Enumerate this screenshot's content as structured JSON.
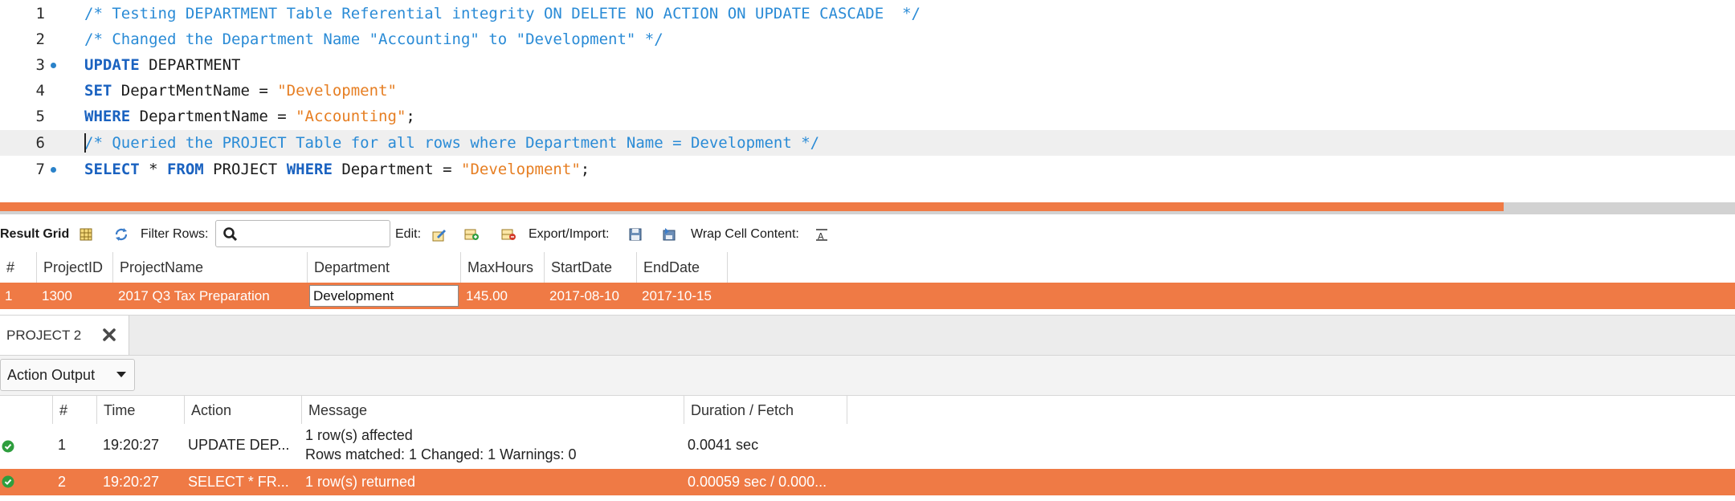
{
  "editor": {
    "lines": [
      {
        "num": "1",
        "comment": "/* Testing DEPARTMENT Table Referential integrity ON DELETE NO ACTION ON UPDATE CASCADE  */"
      },
      {
        "num": "2",
        "comment": "/* Changed the Department Name \"Accounting\" to \"Development\" */"
      },
      {
        "num": "3",
        "kw1": "UPDATE",
        "id1": " DEPARTMENT"
      },
      {
        "num": "4",
        "kw1": "SET",
        "id1": " DepartMentName = ",
        "str1": "\"Development\""
      },
      {
        "num": "5",
        "kw1": "WHERE",
        "id1": " DepartmentName = ",
        "str1": "\"Accounting\"",
        "tail": ";"
      },
      {
        "num": "6",
        "comment": "/* Queried the PROJECT Table for all rows where Department Name = Development */"
      },
      {
        "num": "7",
        "kw1": "SELECT",
        "id1": " * ",
        "kw2": "FROM",
        "id2": " PROJECT ",
        "kw3": "WHERE",
        "id3": " Department = ",
        "str1": "\"Development\"",
        "tail": ";"
      }
    ]
  },
  "toolbar": {
    "result_grid": "Result Grid",
    "filter_rows": "Filter Rows:",
    "edit": "Edit:",
    "export_import": "Export/Import:",
    "wrap_cell": "Wrap Cell Content:"
  },
  "grid": {
    "columns": [
      "#",
      "ProjectID",
      "ProjectName",
      "Department",
      "MaxHours",
      "StartDate",
      "EndDate"
    ],
    "rows": [
      [
        "1",
        "1300",
        "2017 Q3 Tax Preparation",
        "Development",
        "145.00",
        "2017-08-10",
        "2017-10-15"
      ]
    ]
  },
  "tab": {
    "label": "PROJECT 2"
  },
  "output": {
    "selector": "Action Output",
    "columns": [
      "#",
      "Time",
      "Action",
      "Message",
      "Duration / Fetch"
    ],
    "rows": [
      {
        "num": "1",
        "time": "19:20:27",
        "action": "UPDATE DEP...",
        "message1": "1 row(s) affected",
        "message2": "Rows matched: 1  Changed: 1  Warnings: 0",
        "duration": "0.0041 sec"
      },
      {
        "num": "2",
        "time": "19:20:27",
        "action": "SELECT * FR...",
        "message1": "1 row(s) returned",
        "duration": "0.00059 sec / 0.000..."
      }
    ]
  },
  "colors": {
    "accent": "#ef7a45",
    "comment": "#2a8bd6",
    "keyword": "#1a62c0",
    "string": "#e67e22",
    "ok": "#2e9e3e"
  }
}
